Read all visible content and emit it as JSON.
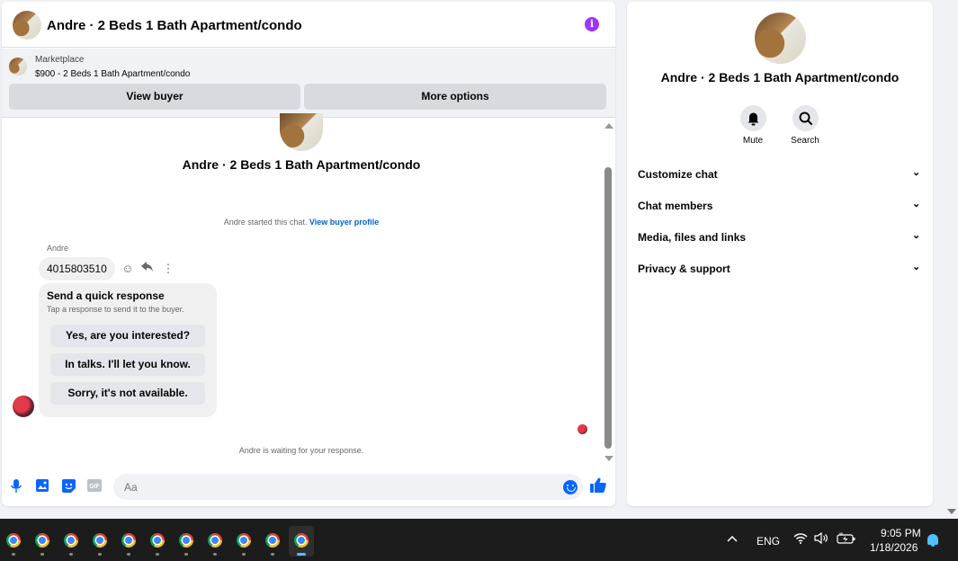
{
  "chat": {
    "header_title": "Andre · 2 Beds 1 Bath Apartment/condo",
    "info_icon": "i",
    "marketplace_label": "Marketplace",
    "listing_title": "$900 - 2 Beds 1 Bath Apartment/condo",
    "view_buyer": "View buyer",
    "more_options": "More options",
    "thread_title": "Andre · 2 Beds 1 Bath Apartment/condo",
    "started_text": "Andre started this chat.",
    "view_buyer_profile": "View buyer profile",
    "sender_name": "Andre",
    "message_text": "4015803510",
    "quick_response": {
      "title": "Send a quick response",
      "subtitle": "Tap a response to send it to the buyer.",
      "options": [
        "Yes, are you interested?",
        "In talks. I'll let you know.",
        "Sorry, it's not available."
      ]
    },
    "waiting_text": "Andre is waiting for your response.",
    "composer_placeholder": "Aa"
  },
  "info_panel": {
    "title": "Andre · 2 Beds 1 Bath Apartment/condo",
    "actions": [
      "Mute",
      "Search"
    ],
    "sections": [
      "Customize chat",
      "Chat members",
      "Media, files and links",
      "Privacy & support"
    ]
  },
  "taskbar": {
    "language": "ENG",
    "time": "9:05 PM",
    "date": "1/18/2026"
  },
  "colors": {
    "accent": "#0866ff",
    "info": "#a033ff",
    "link": "#0064d1"
  }
}
